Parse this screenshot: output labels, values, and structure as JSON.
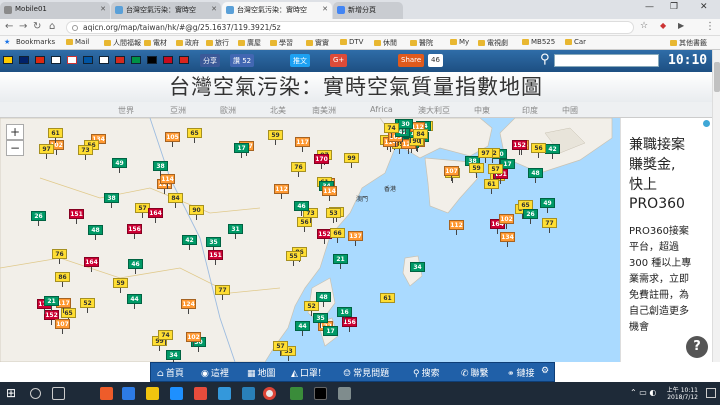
{
  "browser": {
    "tabs": [
      {
        "title": "Mobile01"
      },
      {
        "title": "台灣空氣污染：實時空"
      },
      {
        "title": "台灣空氣污染：實時空"
      },
      {
        "title": "新增分頁"
      }
    ],
    "url": "aqicn.org/map/taiwan/hk/#@g/25.1637/119.3921/5z",
    "bookmarks_label": "Bookmarks",
    "bookmarks": [
      "Mail",
      "人間福報",
      "電材",
      "政府",
      "旅行",
      "廣屋",
      "學習",
      "實實",
      "DTV",
      "休閒",
      "醫院",
      "My",
      "電視劇",
      "MB525",
      "Car"
    ],
    "other_bookmarks": "其他書籤"
  },
  "site": {
    "share_buttons": [
      {
        "label": "分享",
        "color": "#3b5998"
      },
      {
        "label": "讚 52",
        "color": "#4267b2"
      },
      {
        "label": "推文",
        "color": "#1da1f2"
      },
      {
        "label": "G+",
        "color": "#dd4b39"
      },
      {
        "label": "Share",
        "color": "#e05a1c"
      },
      {
        "label": "46",
        "color": "#fff"
      }
    ],
    "clock": "10:10",
    "title": "台灣空氣污染：實時空氣質量指數地圖",
    "regions": [
      "世界",
      "亞洲",
      "歐洲",
      "北美",
      "南美洲",
      "Africa",
      "澳大利亞",
      "中東",
      "印度",
      "中國"
    ],
    "zoom": {
      "in": "+",
      "out": "−"
    },
    "ad": {
      "lines": [
        "兼職接案",
        "賺獎金,",
        "快上",
        "PRO360"
      ],
      "body": [
        "PRO360接案",
        "平台，超過",
        "300 種以上專",
        "業需求，立即",
        "免費註冊，為",
        "自己創造更多",
        "機會"
      ]
    },
    "help": "?",
    "footer_nav": [
      {
        "icon": "home-icon",
        "label": "首頁",
        "glyph": "⌂"
      },
      {
        "icon": "pin-icon",
        "label": "這裡",
        "glyph": "◉"
      },
      {
        "icon": "map-icon",
        "label": "地圖",
        "glyph": "▦"
      },
      {
        "icon": "mask-icon",
        "label": "口罩!",
        "glyph": "◭"
      },
      {
        "icon": "faq-icon",
        "label": "常見問題",
        "glyph": "☺"
      },
      {
        "icon": "search-icon",
        "label": "搜索",
        "glyph": "⚲"
      },
      {
        "icon": "contact-icon",
        "label": "聯繫",
        "glyph": "✆"
      },
      {
        "icon": "link-icon",
        "label": "鏈接",
        "glyph": "⚭"
      },
      {
        "icon": "gear-icon",
        "label": "",
        "glyph": "⚙"
      }
    ]
  },
  "aqi_stations": [
    {
      "v": "164",
      "c": "#cc0033"
    },
    {
      "v": "122",
      "c": "#ff9933"
    },
    {
      "v": "152",
      "c": "#cc0033"
    },
    {
      "v": "112",
      "c": "#ff9933"
    },
    {
      "v": "76",
      "c": "#ffde33"
    },
    {
      "v": "65",
      "c": "#ffde33"
    },
    {
      "v": "137",
      "c": "#ff9933"
    },
    {
      "v": "107",
      "c": "#ff9933"
    },
    {
      "v": "105",
      "c": "#ff9933"
    },
    {
      "v": "117",
      "c": "#ff9933"
    },
    {
      "v": "102",
      "c": "#ff9933"
    },
    {
      "v": "53",
      "c": "#ffde33"
    },
    {
      "v": "56",
      "c": "#ffde33"
    },
    {
      "v": "42",
      "c": "#009966"
    },
    {
      "v": "46",
      "c": "#009966"
    },
    {
      "v": "38",
      "c": "#009966"
    },
    {
      "v": "34",
      "c": "#009966"
    },
    {
      "v": "61",
      "c": "#ffde33"
    },
    {
      "v": "17",
      "c": "#009966"
    },
    {
      "v": "170",
      "c": "#cc0033"
    },
    {
      "v": "151",
      "c": "#cc0033"
    },
    {
      "v": "99",
      "c": "#ffde33"
    },
    {
      "v": "52",
      "c": "#ffde33"
    },
    {
      "v": "30",
      "c": "#009966"
    },
    {
      "v": "21",
      "c": "#009966"
    },
    {
      "v": "59",
      "c": "#ffde33"
    },
    {
      "v": "114",
      "c": "#ff9933"
    },
    {
      "v": "97",
      "c": "#ffde33"
    },
    {
      "v": "84",
      "c": "#ffde33"
    },
    {
      "v": "86",
      "c": "#ffde33"
    },
    {
      "v": "57",
      "c": "#ffde33"
    },
    {
      "v": "35",
      "c": "#009966"
    },
    {
      "v": "48",
      "c": "#009966"
    },
    {
      "v": "74",
      "c": "#ffde33"
    },
    {
      "v": "66",
      "c": "#ffde33"
    },
    {
      "v": "49",
      "c": "#009966"
    },
    {
      "v": "124",
      "c": "#ff9933"
    },
    {
      "v": "156",
      "c": "#cc0033"
    },
    {
      "v": "77",
      "c": "#ffde33"
    },
    {
      "v": "16",
      "c": "#009966"
    },
    {
      "v": "134",
      "c": "#ff9933"
    },
    {
      "v": "90",
      "c": "#ffde33"
    },
    {
      "v": "73",
      "c": "#ffde33"
    },
    {
      "v": "55",
      "c": "#ffde33"
    },
    {
      "v": "89",
      "c": "#ffde33"
    },
    {
      "v": "26",
      "c": "#009966"
    },
    {
      "v": "31",
      "c": "#009966"
    },
    {
      "v": "44",
      "c": "#009966"
    }
  ],
  "map_labels": [
    "香港",
    "澳門"
  ],
  "taskbar": {
    "time": "上午 10:11",
    "date": "2018/7/12"
  }
}
